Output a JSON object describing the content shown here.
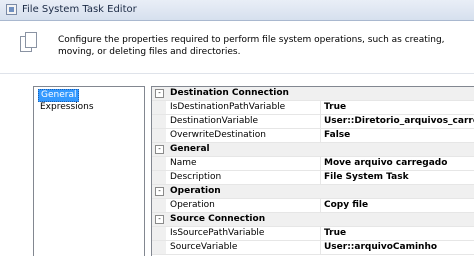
{
  "window": {
    "title": "File System Task Editor"
  },
  "header": {
    "description": "Configure the properties required to perform file system operations, such as creating, moving, or deleting files and directories."
  },
  "nav": {
    "items": [
      {
        "label": "General"
      },
      {
        "label": "Expressions"
      }
    ]
  },
  "grid": {
    "categories": [
      {
        "label": "Destination Connection",
        "toggle": "-",
        "rows": [
          {
            "name": "IsDestinationPathVariable",
            "value": "True"
          },
          {
            "name": "DestinationVariable",
            "value": "User::Diretorio_arquivos_carregados"
          },
          {
            "name": "OverwriteDestination",
            "value": "False"
          }
        ]
      },
      {
        "label": "General",
        "toggle": "-",
        "rows": [
          {
            "name": "Name",
            "value": "Move arquivo carregado"
          },
          {
            "name": "Description",
            "value": "File System Task"
          }
        ]
      },
      {
        "label": "Operation",
        "toggle": "-",
        "rows": [
          {
            "name": "Operation",
            "value": "Copy file"
          }
        ]
      },
      {
        "label": "Source Connection",
        "toggle": "-",
        "rows": [
          {
            "name": "IsSourcePathVariable",
            "value": "True"
          },
          {
            "name": "SourceVariable",
            "value": "User::arquivoCaminho"
          }
        ]
      }
    ]
  }
}
